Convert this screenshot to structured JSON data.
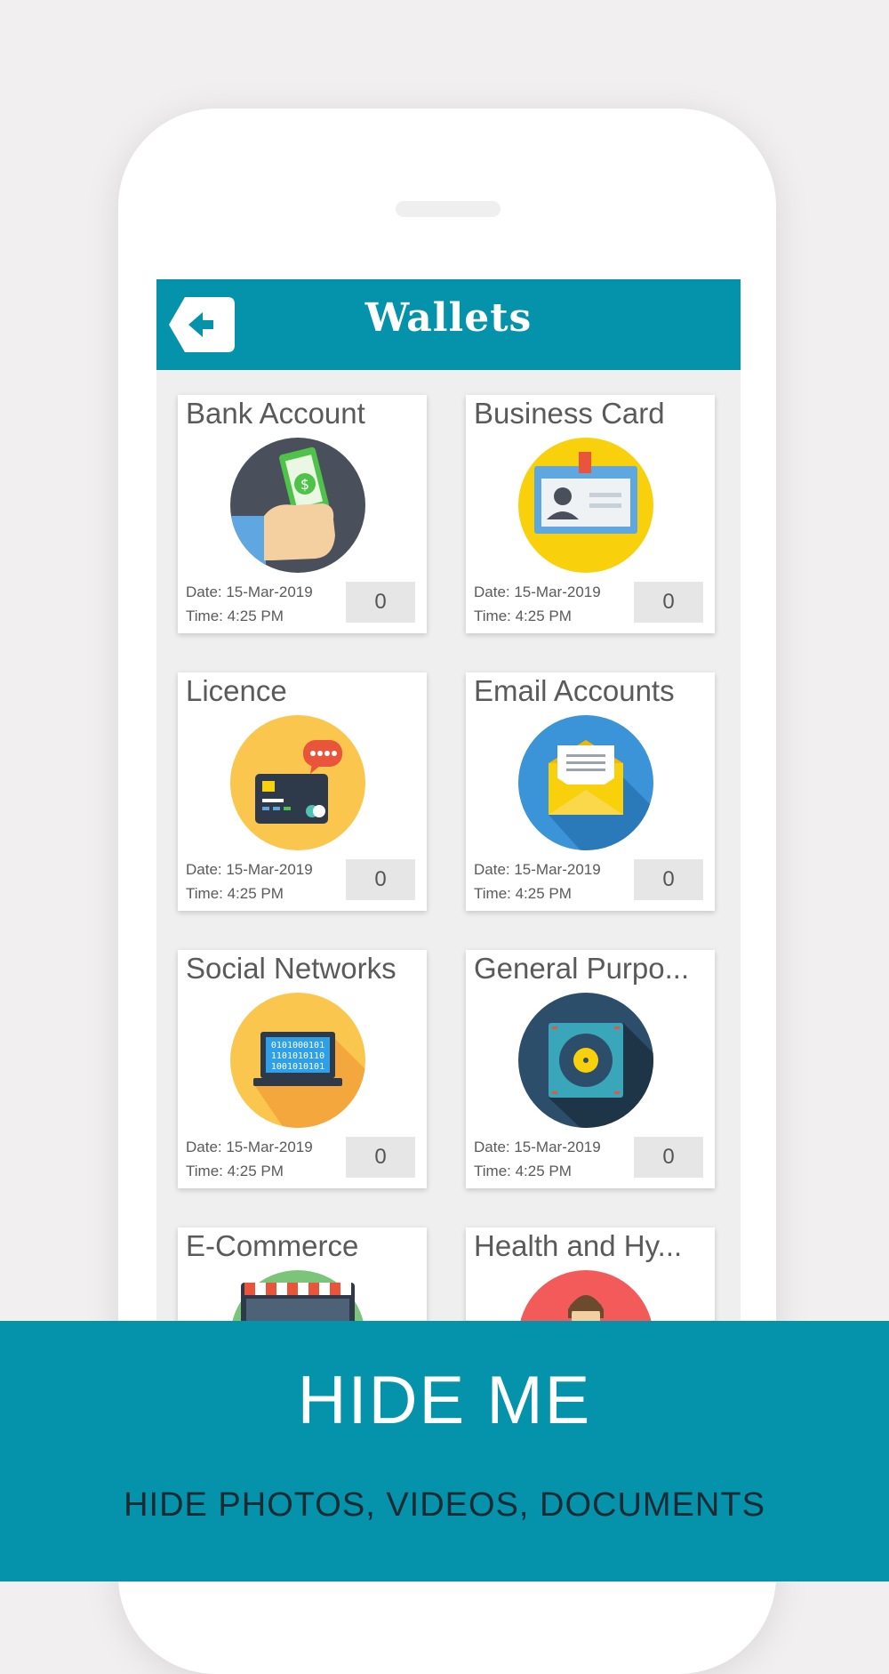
{
  "app": {
    "title": "Wallets"
  },
  "back_button": {
    "icon": "back-arrow-icon"
  },
  "cards": [
    {
      "title": "Bank Account",
      "icon": "bank-account-icon",
      "date": "Date: 15-Mar-2019",
      "time": "Time: 4:25 PM",
      "count": "0"
    },
    {
      "title": "Business Card",
      "icon": "business-card-icon",
      "date": "Date: 15-Mar-2019",
      "time": "Time: 4:25 PM",
      "count": "0"
    },
    {
      "title": "Licence",
      "icon": "licence-card-icon",
      "date": "Date: 15-Mar-2019",
      "time": "Time: 4:25 PM",
      "count": "0"
    },
    {
      "title": "Email Accounts",
      "icon": "email-envelope-icon",
      "date": "Date: 15-Mar-2019",
      "time": "Time: 4:25 PM",
      "count": "0"
    },
    {
      "title": "Social Networks",
      "icon": "laptop-binary-icon",
      "date": "Date: 15-Mar-2019",
      "time": "Time: 4:25 PM",
      "count": "0"
    },
    {
      "title": "General Purpo...",
      "icon": "safe-vault-icon",
      "date": "Date: 15-Mar-2019",
      "time": "Time: 4:25 PM",
      "count": "0"
    },
    {
      "title": "E-Commerce",
      "icon": "storefront-icon"
    },
    {
      "title": "Health and Hy...",
      "icon": "person-health-icon"
    }
  ],
  "banner": {
    "title": "HIDE ME",
    "subtitle": "HIDE PHOTOS, VIDEOS, DOCUMENTS"
  },
  "colors": {
    "primary": "#0592ab",
    "background": "#f0eff0"
  }
}
